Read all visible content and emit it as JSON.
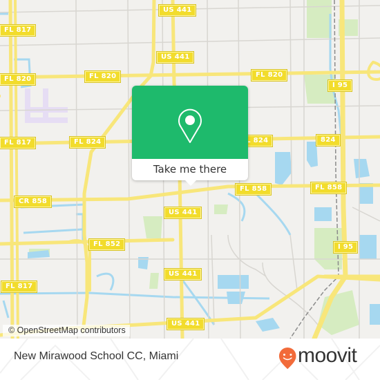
{
  "map": {
    "attribution": "© OpenStreetMap contributors",
    "colors": {
      "land": "#f2f1ee",
      "water": "#a6d8f0",
      "park": "#d6ecc1",
      "road_major": "#f8e67a",
      "road_minor": "#d8d6d1",
      "shield": "#f2dc2c",
      "accent_green": "#1eba6c",
      "brand_orange": "#f26b3a"
    },
    "road_labels": [
      {
        "id": "us441-a",
        "text": "US 441"
      },
      {
        "id": "fl817-a",
        "text": "FL 817"
      },
      {
        "id": "us441-b",
        "text": "US 441"
      },
      {
        "id": "fl820-a",
        "text": "FL 820"
      },
      {
        "id": "fl820-b",
        "text": "FL 820"
      },
      {
        "id": "fl820-c",
        "text": "FL 820"
      },
      {
        "id": "i95-a",
        "text": "I 95"
      },
      {
        "id": "fl817-b",
        "text": "FL 817"
      },
      {
        "id": "fl824-a",
        "text": "FL 824"
      },
      {
        "id": "fl824-b",
        "text": "FL 824"
      },
      {
        "id": "sr824",
        "text": "824"
      },
      {
        "id": "cr858",
        "text": "CR 858"
      },
      {
        "id": "fl858-a",
        "text": "FL 858"
      },
      {
        "id": "fl858-b",
        "text": "FL 858"
      },
      {
        "id": "us441-c",
        "text": "US 441"
      },
      {
        "id": "fl852",
        "text": "FL 852"
      },
      {
        "id": "i95-b",
        "text": "I 95"
      },
      {
        "id": "fl817-c",
        "text": "FL 817"
      },
      {
        "id": "us441-d",
        "text": "US 441"
      },
      {
        "id": "us441-e",
        "text": "US 441"
      }
    ]
  },
  "popup": {
    "icon": "location-pin-icon",
    "button_label": "Take me there"
  },
  "footer": {
    "place_name": "New Mirawood School CC, Miami",
    "brand": "moovit",
    "brand_icon": "moovit-pin-smile-icon"
  }
}
